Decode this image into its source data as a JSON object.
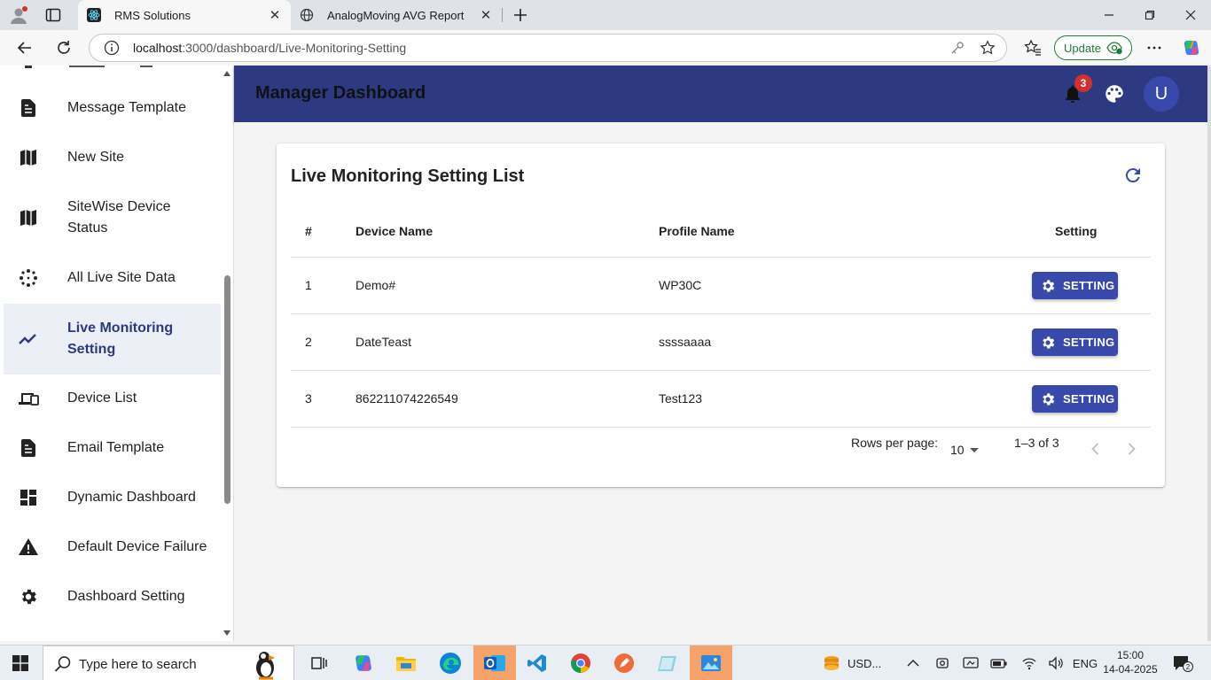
{
  "browser": {
    "tabs": [
      {
        "title": "RMS Solutions",
        "active": true
      },
      {
        "title": "AnalogMoving AVG Report",
        "active": false
      }
    ],
    "url_host": "localhost",
    "url_path": ":3000/dashboard/Live-Monitoring-Setting",
    "update_label": "Update"
  },
  "sidebar": {
    "items": [
      {
        "label": "Message Template",
        "icon": "description-icon"
      },
      {
        "label": "New Site",
        "icon": "map-icon"
      },
      {
        "label": "SiteWise Device Status",
        "icon": "map-icon"
      },
      {
        "label": "All Live Site Data",
        "icon": "scatter-dots-icon"
      },
      {
        "label": "Live Monitoring Setting",
        "icon": "trending-up-icon",
        "selected": true
      },
      {
        "label": "Device List",
        "icon": "devices-icon"
      },
      {
        "label": "Email Template",
        "icon": "description-icon"
      },
      {
        "label": "Dynamic Dashboard",
        "icon": "dashboard-icon"
      },
      {
        "label": "Default Device Failure",
        "icon": "warning-icon"
      },
      {
        "label": "Dashboard Setting",
        "icon": "gear-icon"
      }
    ]
  },
  "header": {
    "title": "Manager Dashboard",
    "notification_count": "3",
    "avatar_initial": "U"
  },
  "card": {
    "title": "Live Monitoring Setting List",
    "columns": [
      "#",
      "Device Name",
      "Profile Name",
      "Setting"
    ],
    "rows": [
      {
        "index": "1",
        "device": "Demo#",
        "profile": "WP30C",
        "button": "SETTING"
      },
      {
        "index": "2",
        "device": "DateTeast",
        "profile": "ssssaaaa",
        "button": "SETTING"
      },
      {
        "index": "3",
        "device": "862211074226549",
        "profile": "Test123",
        "button": "SETTING"
      }
    ],
    "pagination": {
      "rows_per_page_label": "Rows per page:",
      "rows_per_page_value": "10",
      "range": "1–3 of 3"
    }
  },
  "taskbar": {
    "search_placeholder": "Type here to search",
    "tray_currency": "USD...",
    "language": "ENG",
    "time": "15:00",
    "date": "14-04-2025",
    "notification_count": "2"
  },
  "colors": {
    "appbar": "#2d3a82",
    "primary_button": "#3949ab",
    "selected_item_bg": "#eceff5",
    "badge": "#d32f2f"
  }
}
